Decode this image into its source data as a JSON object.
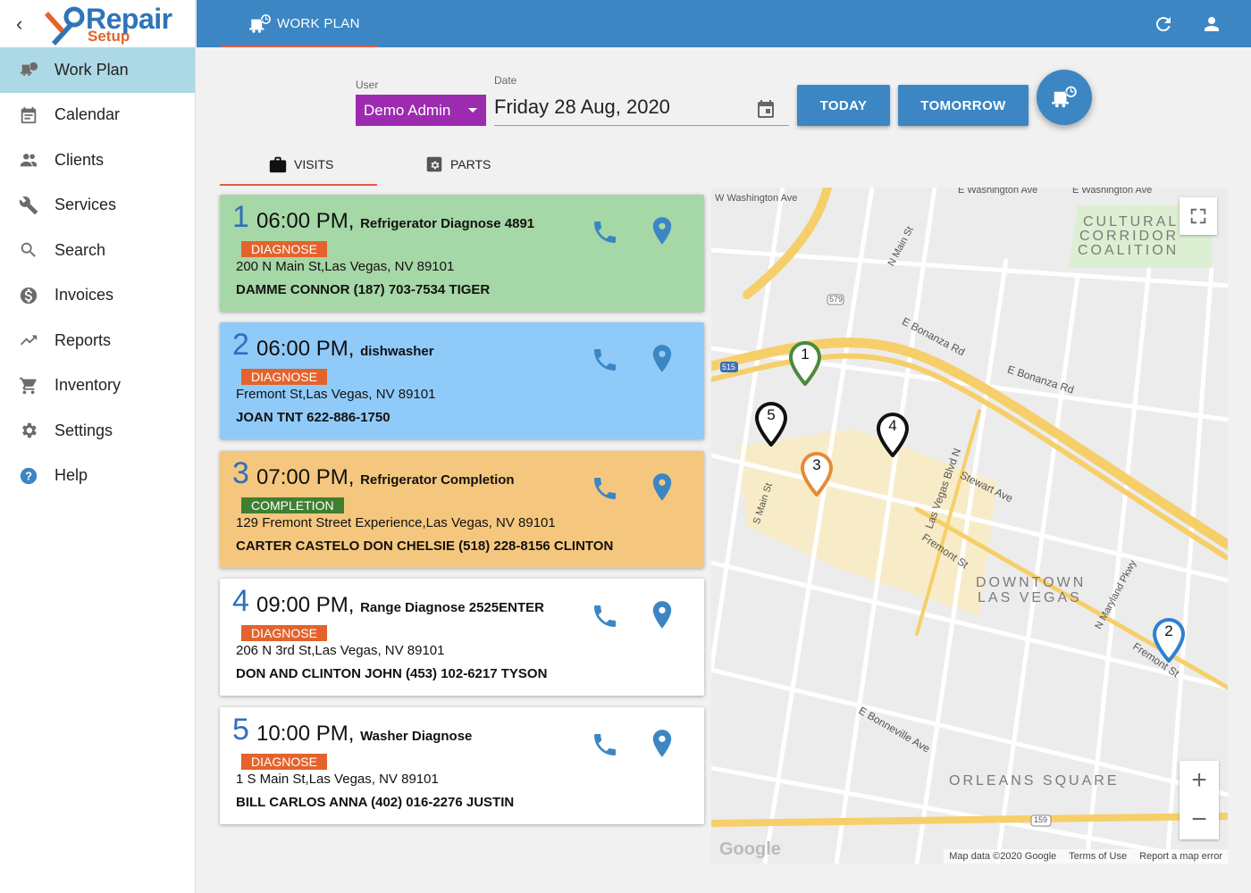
{
  "brand": {
    "name": "Repair",
    "sub": "Setup"
  },
  "sidebar": {
    "items": [
      {
        "label": "Work Plan",
        "icon": "work-plan-icon"
      },
      {
        "label": "Calendar",
        "icon": "calendar-icon"
      },
      {
        "label": "Clients",
        "icon": "clients-icon"
      },
      {
        "label": "Services",
        "icon": "wrench-icon"
      },
      {
        "label": "Search",
        "icon": "search-icon"
      },
      {
        "label": "Invoices",
        "icon": "dollar-icon"
      },
      {
        "label": "Reports",
        "icon": "trending-icon"
      },
      {
        "label": "Inventory",
        "icon": "cart-icon"
      },
      {
        "label": "Settings",
        "icon": "gear-icon"
      },
      {
        "label": "Help",
        "icon": "help-icon"
      }
    ]
  },
  "topbar": {
    "title": "WORK PLAN"
  },
  "controls": {
    "user_label": "User",
    "user_value": "Demo Admin",
    "date_label": "Date",
    "date_value": "Friday 28 Aug, 2020",
    "today_label": "TODAY",
    "tomorrow_label": "TOMORROW"
  },
  "tabs": {
    "visits": "VISITS",
    "parts": "PARTS"
  },
  "colors": {
    "accent": "#3b86c3",
    "user_select": "#9d2bb0",
    "diagnose": "#e4632c",
    "completion": "#3f7f32",
    "card_green": "#a6d7a6",
    "card_blue": "#90caf9",
    "card_orange": "#f5c77e"
  },
  "visits": [
    {
      "num": "1",
      "time": "06:00 PM,",
      "service": "Refrigerator Diagnose 4891",
      "badge": "DIAGNOSE",
      "address": "200 N Main St,Las Vegas, NV 89101",
      "client": "DAMME CONNOR (187) 703-7534 TIGER"
    },
    {
      "num": "2",
      "time": "06:00 PM,",
      "service": "dishwasher",
      "badge": "DIAGNOSE",
      "address": "Fremont St,Las Vegas, NV 89101",
      "client": "JOAN TNT 622-886-1750"
    },
    {
      "num": "3",
      "time": "07:00 PM,",
      "service": "Refrigerator Completion",
      "badge": "COMPLETION",
      "address": "129 Fremont Street Experience,Las Vegas, NV 89101",
      "client": "CARTER CASTELO DON CHELSIE (518) 228-8156 CLINTON"
    },
    {
      "num": "4",
      "time": "09:00 PM,",
      "service": "Range Diagnose 2525ENTER",
      "badge": "DIAGNOSE",
      "address": "206 N 3rd St,Las Vegas, NV 89101",
      "client": "DON AND CLINTON JOHN (453) 102-6217 TYSON"
    },
    {
      "num": "5",
      "time": "10:00 PM,",
      "service": "Washer Diagnose",
      "badge": "DIAGNOSE",
      "address": "1 S Main St,Las Vegas, NV 89101",
      "client": "BILL CARLOS ANNA (402) 016-2276 JUSTIN"
    }
  ],
  "map": {
    "markers": [
      "1",
      "2",
      "3",
      "4",
      "5"
    ],
    "labels": {
      "cultural1": "CULTURAL",
      "cultural2": "CORRIDOR",
      "cultural3": "COALITION",
      "downtown1": "DOWNTOWN",
      "downtown2": "LAS VEGAS",
      "orleans": "ORLEANS SQUARE",
      "bonanza": "E Bonanza Rd",
      "fremont": "Fremont St",
      "lasvegas": "Las Vegas Blvd N",
      "stewart": "Stewart Ave",
      "bonneville": "E Bonneville Ave",
      "washington1": "W Washington Ave",
      "washington2": "E Washington Ave",
      "washington3": "E Washington Ave",
      "mainst": "N Main St",
      "smain": "S Main St",
      "maryland": "N Maryland Pkwy",
      "route579": "579",
      "route515": "515",
      "route159": "159"
    },
    "attribution": [
      "Map data ©2020 Google",
      "Terms of Use",
      "Report a map error"
    ],
    "google": "Google"
  }
}
